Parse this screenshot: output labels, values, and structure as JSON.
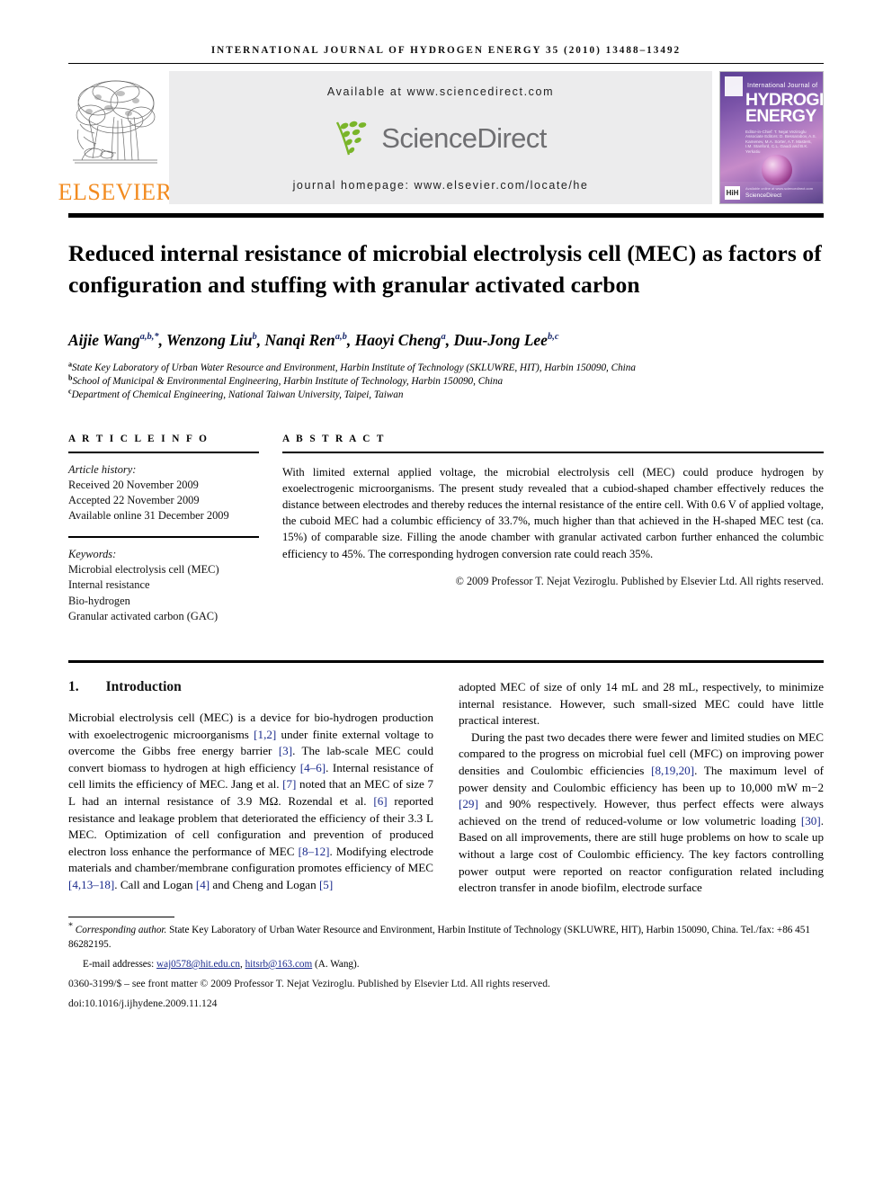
{
  "running_head": "INTERNATIONAL JOURNAL OF HYDROGEN ENERGY 35 (2010) 13488–13492",
  "masthead": {
    "publisher_name": "ELSEVIER",
    "available_at": "Available at www.sciencedirect.com",
    "sciencedirect_label": "ScienceDirect",
    "journal_homepage": "journal homepage: www.elsevier.com/locate/he",
    "cover": {
      "line_small": "International Journal of",
      "line_1": "HYDROGEN",
      "line_2": "ENERGY",
      "editors": "Editor-in-Chief:  T. Nejat Veziroglu\nAssociate Editors:  D. Bessarabov, A.S. Kamenev, M.A. Sorter,\nA.T. Masters, I.M. Stanford,\nC.L. Gaudi and B.K. Yerkatiu",
      "sciencedirect": "ScienceDirect",
      "sciencedirect_above": "Available online at www.sciencedirect.com",
      "hih_badge": "HiH"
    }
  },
  "article": {
    "title": "Reduced internal resistance of microbial electrolysis cell (MEC) as factors of configuration and stuffing with granular activated carbon",
    "authors": [
      {
        "name": "Aijie Wang",
        "marks": "a,b,*"
      },
      {
        "name": "Wenzong Liu",
        "marks": "b"
      },
      {
        "name": "Nanqi Ren",
        "marks": "a,b"
      },
      {
        "name": "Haoyi Cheng",
        "marks": "a"
      },
      {
        "name": "Duu-Jong Lee",
        "marks": "b,c"
      }
    ],
    "affiliations": [
      {
        "mark": "a",
        "text": "State Key Laboratory of Urban Water Resource and Environment, Harbin Institute of Technology (SKLUWRE, HIT), Harbin 150090, China"
      },
      {
        "mark": "b",
        "text": "School of Municipal & Environmental Engineering, Harbin Institute of Technology, Harbin 150090, China"
      },
      {
        "mark": "c",
        "text": "Department of Chemical Engineering, National Taiwan University, Taipei, Taiwan"
      }
    ]
  },
  "article_info": {
    "heading": "A R T I C L E   I N F O",
    "history_label": "Article history:",
    "history": [
      "Received 20 November 2009",
      "Accepted 22 November 2009",
      "Available online 31 December 2009"
    ],
    "keywords_label": "Keywords:",
    "keywords": [
      "Microbial electrolysis cell (MEC)",
      "Internal resistance",
      "Bio-hydrogen",
      "Granular activated carbon (GAC)"
    ]
  },
  "abstract": {
    "heading": "A B S T R A C T",
    "text": "With limited external applied voltage, the microbial electrolysis cell (MEC) could produce hydrogen by exoelectrogenic microorganisms. The present study revealed that a cubiod-shaped chamber effectively reduces the distance between electrodes and thereby reduces the internal resistance of the entire cell. With 0.6 V of applied voltage, the cuboid MEC had a columbic efficiency of 33.7%, much higher than that achieved in the H-shaped MEC test (ca. 15%) of comparable size. Filling the anode chamber with granular activated carbon further enhanced the columbic efficiency to 45%. The corresponding hydrogen conversion rate could reach 35%.",
    "copyright": "© 2009 Professor T. Nejat Veziroglu. Published by Elsevier Ltd. All rights reserved."
  },
  "body": {
    "section_number": "1.",
    "section_title": "Introduction",
    "left_paragraphs": [
      "Microbial electrolysis cell (MEC) is a device for bio-hydrogen production with exoelectrogenic microorganisms [1,2] under finite external voltage to overcome the Gibbs free energy barrier [3]. The lab-scale MEC could convert biomass to hydrogen at high efficiency [4–6]. Internal resistance of cell limits the efficiency of MEC. Jang et al. [7] noted that an MEC of size 7 L had an internal resistance of 3.9 MΩ. Rozendal et al. [6] reported resistance and leakage problem that deteriorated the efficiency of their 3.3 L MEC. Optimization of cell configuration and prevention of produced electron loss enhance the performance of MEC [8–12]. Modifying electrode materials and chamber/membrane configuration promotes efficiency of MEC [4,13–18]. Call and Logan [4] and Cheng and Logan [5]"
    ],
    "right_paragraphs": [
      "adopted MEC of size of only 14 mL and 28 mL, respectively, to minimize internal resistance. However, such small-sized MEC could have little practical interest.",
      "During the past two decades there were fewer and limited studies on MEC compared to the progress on microbial fuel cell (MFC) on improving power densities and Coulombic efficiencies [8,19,20]. The maximum level of power density and Coulombic efficiency has been up to 10,000 mW m−2 [29] and 90% respectively. However, thus perfect effects were always achieved on the trend of reduced-volume or low volumetric loading [30]. Based on all improvements, there are still huge problems on how to scale up without a large cost of Coulombic efficiency. The key factors controlling power output were reported on reactor configuration related including electron transfer in anode biofilm, electrode surface"
    ]
  },
  "footnotes": {
    "corresponding_mark": "*",
    "corresponding_label": "Corresponding author.",
    "corresponding_text": " State Key Laboratory of Urban Water Resource and Environment, Harbin Institute of Technology (SKLUWRE, HIT), Harbin 150090, China. Tel./fax: +86 451 86282195.",
    "email_label": "E-mail addresses:",
    "email_1": "waj0578@hit.edu.cn",
    "email_2": "hitsrb@163.com",
    "email_owner": "(A. Wang).",
    "issn_line": "0360-3199/$ – see front matter © 2009 Professor T. Nejat Veziroglu. Published by Elsevier Ltd. All rights reserved.",
    "doi_line": "doi:10.1016/j.ijhydene.2009.11.124"
  },
  "colors": {
    "elsevier_orange": "#F28B20",
    "reference_blue": "#1a2a8c",
    "panel_grey": "#ececed",
    "sciencedirect_grey": "#6f6f72",
    "sciencedirect_green": "#7ab52a"
  }
}
